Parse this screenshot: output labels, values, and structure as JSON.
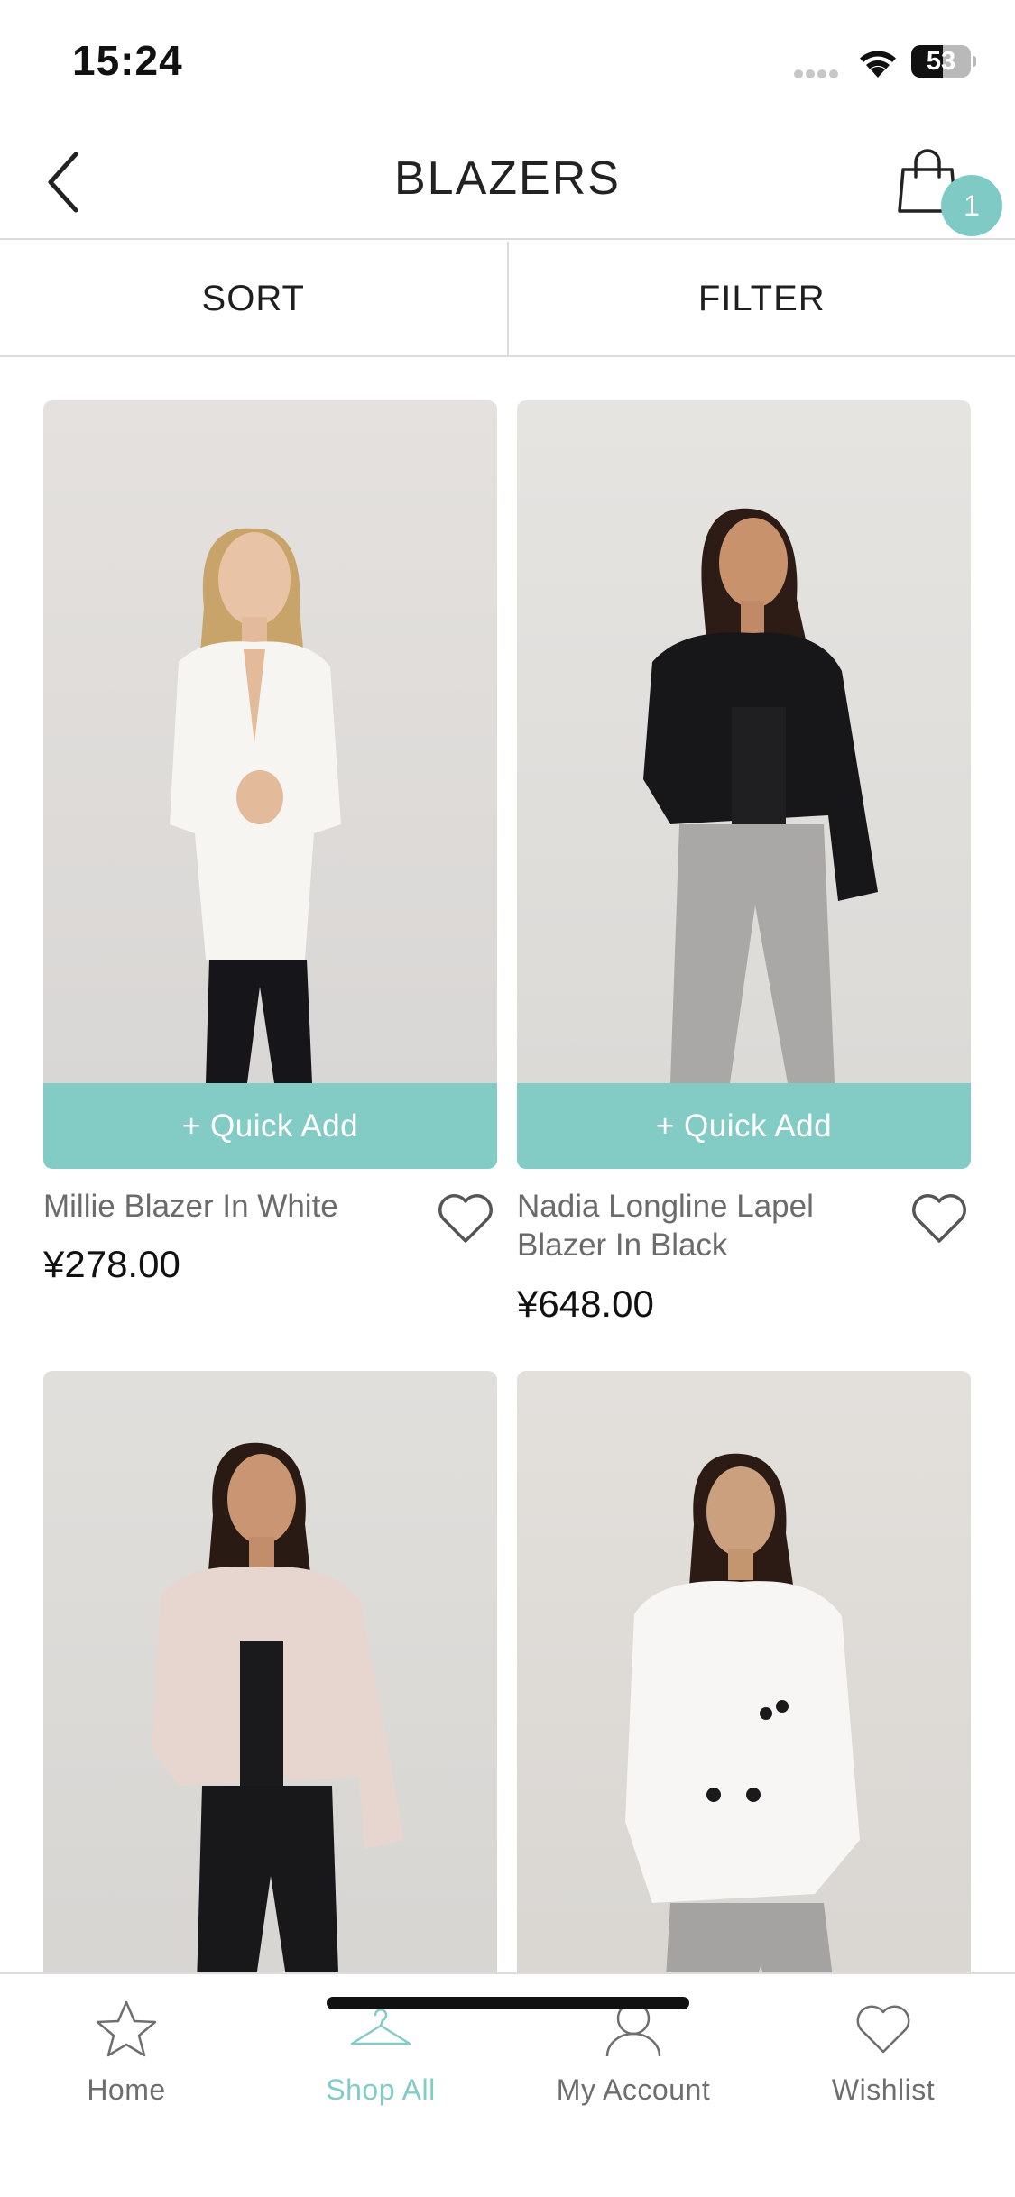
{
  "status_bar": {
    "time": "15:24",
    "battery": "53"
  },
  "header": {
    "title": "BLAZERS",
    "cart_count": "1"
  },
  "toolbar": {
    "sort_label": "SORT",
    "filter_label": "FILTER"
  },
  "products": [
    {
      "name": "Millie Blazer In White",
      "price": "¥278.00",
      "quick_add": "+ Quick Add"
    },
    {
      "name": "Nadia Longline Lapel Blazer In Black",
      "price": "¥648.00",
      "quick_add": "+ Quick Add"
    },
    {
      "name": "",
      "price": "",
      "quick_add": ""
    },
    {
      "name": "",
      "price": "",
      "quick_add": ""
    }
  ],
  "bottom_nav": {
    "items": [
      {
        "label": "Home",
        "icon": "star-icon",
        "active": false
      },
      {
        "label": "Shop All",
        "icon": "hanger-icon",
        "active": true
      },
      {
        "label": "My Account",
        "icon": "user-icon",
        "active": false
      },
      {
        "label": "Wishlist",
        "icon": "heart-icon",
        "active": false
      }
    ]
  },
  "colors": {
    "accent": "#83ccc6",
    "badge": "#7fcac4",
    "text": "#1c1c1c",
    "muted": "#6e6e6e",
    "divider": "#dcdcdc"
  }
}
